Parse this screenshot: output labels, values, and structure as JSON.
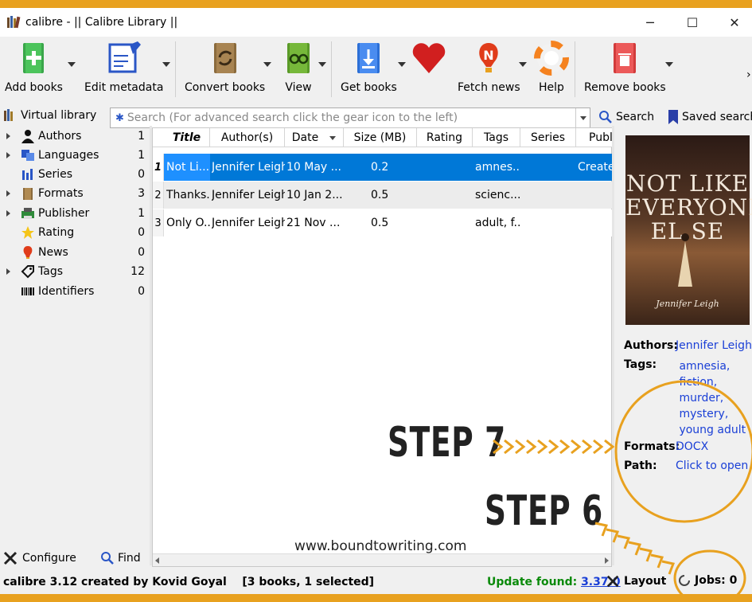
{
  "window": {
    "title": "calibre - || Calibre Library ||",
    "controls": {
      "minimize": "─",
      "maximize": "☐",
      "close": "✕"
    }
  },
  "toolbar": {
    "buttons": [
      {
        "label": "Add books",
        "icon": "add-books-icon"
      },
      {
        "label": "Edit metadata",
        "icon": "edit-metadata-icon"
      },
      {
        "label": "Convert books",
        "icon": "convert-books-icon"
      },
      {
        "label": "View",
        "icon": "view-icon"
      },
      {
        "label": "Get books",
        "icon": "get-books-icon"
      },
      {
        "label": "",
        "icon": "heart-icon"
      },
      {
        "label": "Fetch news",
        "icon": "fetch-news-icon"
      },
      {
        "label": "Help",
        "icon": "help-icon"
      },
      {
        "label": "Remove books",
        "icon": "remove-books-icon"
      }
    ],
    "overflow": "›"
  },
  "searchbar": {
    "virtual_library": "Virtual library",
    "placeholder": "Search (For advanced search click the gear icon to the left)",
    "search_label": "Search",
    "saved_search_label": "Saved search"
  },
  "sidebar": {
    "items": [
      {
        "name": "Authors",
        "count": "1",
        "expandable": true
      },
      {
        "name": "Languages",
        "count": "1",
        "expandable": true
      },
      {
        "name": "Series",
        "count": "0",
        "expandable": false
      },
      {
        "name": "Formats",
        "count": "3",
        "expandable": true
      },
      {
        "name": "Publisher",
        "count": "1",
        "expandable": true
      },
      {
        "name": "Rating",
        "count": "0",
        "expandable": false
      },
      {
        "name": "News",
        "count": "0",
        "expandable": false
      },
      {
        "name": "Tags",
        "count": "12",
        "expandable": true
      },
      {
        "name": "Identifiers",
        "count": "0",
        "expandable": false
      }
    ],
    "configure_label": "Configure",
    "find_label": "Find"
  },
  "booklist": {
    "columns": [
      "Title",
      "Author(s)",
      "Date",
      "Size (MB)",
      "Rating",
      "Tags",
      "Series",
      "Publ"
    ],
    "rows": [
      {
        "num": "1",
        "title": "Not Li...",
        "author": "Jennifer Leigh",
        "date": "10 May ...",
        "size": "0.2",
        "rating": "",
        "tags": "amnes...",
        "series": "",
        "pub": "Create:",
        "selected": true
      },
      {
        "num": "2",
        "title": "Thanks...",
        "author": "Jennifer Leigh",
        "date": "10 Jan 2...",
        "size": "0.5",
        "rating": "",
        "tags": "scienc...",
        "series": "",
        "pub": "",
        "selected": false
      },
      {
        "num": "3",
        "title": "Only O...",
        "author": "Jennifer Leigh",
        "date": "21 Nov ...",
        "size": "0.5",
        "rating": "",
        "tags": "adult, f...",
        "series": "",
        "pub": "",
        "selected": false
      }
    ]
  },
  "details": {
    "cover_title_lines": [
      "NOT LIKE",
      "EVERYONE",
      "EL   SE"
    ],
    "cover_author": "Jennifer Leigh",
    "authors_key": "Authors:",
    "authors_val": "Jennifer Leigh",
    "tags_key": "Tags:",
    "tags_vals": [
      "amnesia,",
      "fiction,",
      "murder,",
      "mystery,",
      "young adult"
    ],
    "formats_key": "Formats:",
    "formats_val": "DOCX",
    "path_key": "Path:",
    "path_val": "Click to open"
  },
  "statusbar": {
    "left": "calibre 3.12 created by Kovid Goyal    [3 books, 1 selected]",
    "update_label": "Update found:",
    "update_version": "3.37.0",
    "layout_label": "Layout",
    "jobs_label": "Jobs: 0"
  },
  "annotations": {
    "step7": "STEP 7",
    "step6": "STEP 6",
    "website": "www.boundtowriting.com",
    "arrow_color": "#e8a11f"
  }
}
